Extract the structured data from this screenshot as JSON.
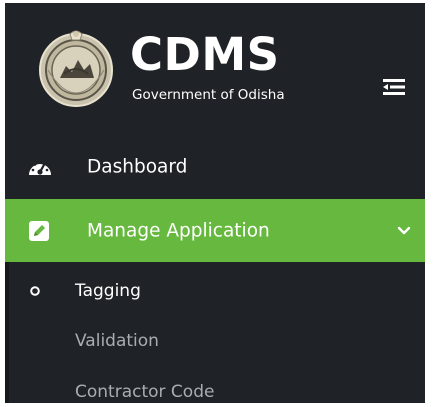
{
  "brand": {
    "title": "CDMS",
    "subtitle": "Government of Odisha",
    "logo_icon": "odisha-state-emblem"
  },
  "header": {
    "toggle_icon": "sidebar-toggle-icon"
  },
  "menu": {
    "items": [
      {
        "label": "Dashboard",
        "icon": "speedometer-icon",
        "active": false
      },
      {
        "label": "Manage Application",
        "icon": "edit-icon",
        "active": true,
        "expanded": true
      }
    ],
    "submenu": [
      {
        "label": "Tagging",
        "selected": true
      },
      {
        "label": "Validation",
        "selected": false
      },
      {
        "label": "Contractor Code",
        "selected": false
      }
    ]
  },
  "colors": {
    "sidebar_bg": "#1f2226",
    "active_bg": "#66b83e",
    "text_primary": "#ffffff",
    "text_muted": "#a9acb0"
  }
}
